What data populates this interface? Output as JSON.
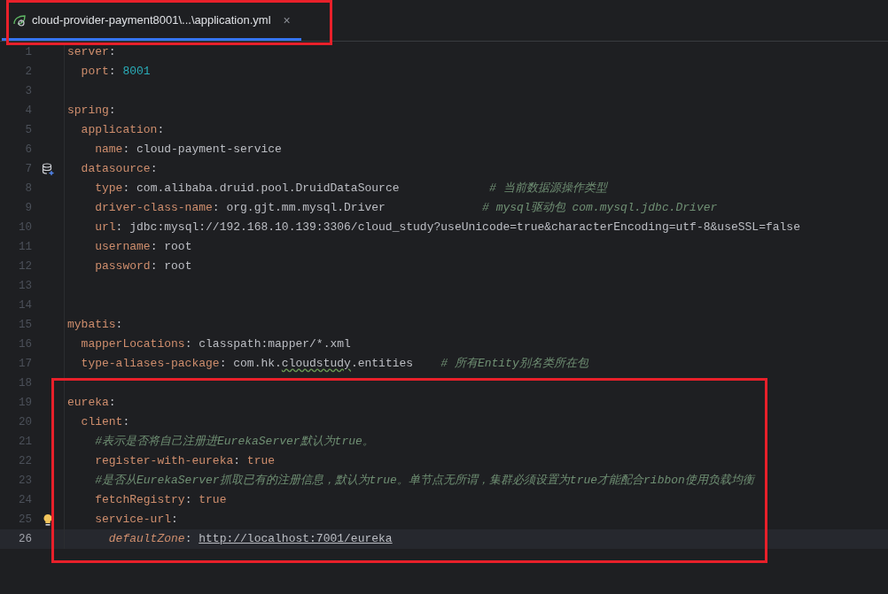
{
  "tab": {
    "label": "cloud-provider-payment8001\\...\\application.yml",
    "close": "×",
    "selected": true
  },
  "lines": [
    {
      "number": "1",
      "current": false,
      "tokens": [
        {
          "kind": "key",
          "text": "server"
        },
        {
          "kind": "punct",
          "text": ":"
        }
      ]
    },
    {
      "number": "2",
      "current": false,
      "tokens": [
        {
          "kind": "key",
          "text": "  port"
        },
        {
          "kind": "punct",
          "text": ": "
        },
        {
          "kind": "number",
          "text": "8001"
        }
      ]
    },
    {
      "number": "3",
      "current": false
    },
    {
      "number": "4",
      "current": false,
      "tokens": [
        {
          "kind": "key",
          "text": "spring"
        },
        {
          "kind": "punct",
          "text": ":"
        }
      ]
    },
    {
      "number": "5",
      "current": false,
      "tokens": [
        {
          "kind": "key",
          "text": "  application"
        },
        {
          "kind": "punct",
          "text": ":"
        }
      ]
    },
    {
      "number": "6",
      "current": false,
      "tokens": [
        {
          "kind": "key",
          "text": "    name"
        },
        {
          "kind": "punct",
          "text": ": "
        },
        {
          "kind": "value",
          "text": "cloud-payment-service"
        }
      ]
    },
    {
      "number": "7",
      "current": false,
      "kind": "database",
      "tokens": [
        {
          "kind": "key",
          "text": "  datasource"
        },
        {
          "kind": "punct",
          "text": ":"
        }
      ]
    },
    {
      "number": "8",
      "current": false,
      "tokens": [
        {
          "kind": "key",
          "text": "    type"
        },
        {
          "kind": "punct",
          "text": ": "
        },
        {
          "kind": "value",
          "text": "com.alibaba.druid.pool.DruidDataSource"
        },
        {
          "kind": "comment",
          "text": "             # 当前数据源操作类型"
        }
      ]
    },
    {
      "number": "9",
      "current": false,
      "tokens": [
        {
          "kind": "key",
          "text": "    driver-class-name"
        },
        {
          "kind": "punct",
          "text": ": "
        },
        {
          "kind": "value",
          "text": "org.gjt.mm.mysql.Driver"
        },
        {
          "kind": "comment",
          "text": "              # mysql驱动包 com.mysql.jdbc.Driver"
        }
      ]
    },
    {
      "number": "10",
      "current": false,
      "tokens": [
        {
          "kind": "key",
          "text": "    url"
        },
        {
          "kind": "punct",
          "text": ": "
        },
        {
          "kind": "value",
          "text": "jdbc:mysql://192.168.10.139:3306/cloud_study?useUnicode=true&characterEncoding=utf-8&useSSL=false"
        }
      ]
    },
    {
      "number": "11",
      "current": false,
      "tokens": [
        {
          "kind": "key",
          "text": "    username"
        },
        {
          "kind": "punct",
          "text": ": "
        },
        {
          "kind": "value",
          "text": "root"
        }
      ]
    },
    {
      "number": "12",
      "current": false,
      "tokens": [
        {
          "kind": "key",
          "text": "    password"
        },
        {
          "kind": "punct",
          "text": ": "
        },
        {
          "kind": "value",
          "text": "root"
        }
      ]
    },
    {
      "number": "13",
      "current": false
    },
    {
      "number": "14",
      "current": false
    },
    {
      "number": "15",
      "current": false,
      "tokens": [
        {
          "kind": "key",
          "text": "mybatis"
        },
        {
          "kind": "punct",
          "text": ":"
        }
      ]
    },
    {
      "number": "16",
      "current": false,
      "tokens": [
        {
          "kind": "key",
          "text": "  mapperLocations"
        },
        {
          "kind": "punct",
          "text": ": "
        },
        {
          "kind": "value",
          "text": "classpath:mapper/*.xml"
        }
      ]
    },
    {
      "number": "17",
      "current": false,
      "tokens": [
        {
          "kind": "key",
          "text": "  type-aliases-package"
        },
        {
          "kind": "punct",
          "text": ": "
        },
        {
          "kind": "value",
          "text": "com.hk."
        },
        {
          "kind": "typo",
          "text": "cloudstudy"
        },
        {
          "kind": "value",
          "text": ".entities"
        },
        {
          "kind": "comment",
          "text": "    # 所有Entity别名类所在包"
        }
      ]
    },
    {
      "number": "18",
      "current": false
    },
    {
      "number": "19",
      "current": false,
      "tokens": [
        {
          "kind": "key",
          "text": "eureka"
        },
        {
          "kind": "punct",
          "text": ":"
        }
      ]
    },
    {
      "number": "20",
      "current": false,
      "tokens": [
        {
          "kind": "key",
          "text": "  client"
        },
        {
          "kind": "punct",
          "text": ":"
        }
      ]
    },
    {
      "number": "21",
      "current": false,
      "tokens": [
        {
          "kind": "comment",
          "text": "    #表示是否将自己注册进EurekaServer默认为true。"
        }
      ]
    },
    {
      "number": "22",
      "current": false,
      "tokens": [
        {
          "kind": "key",
          "text": "    register-with-eureka"
        },
        {
          "kind": "punct",
          "text": ": "
        },
        {
          "kind": "keyword",
          "text": "true"
        }
      ]
    },
    {
      "number": "23",
      "current": false,
      "tokens": [
        {
          "kind": "comment",
          "text": "    #是否从EurekaServer抓取已有的注册信息，默认为true。单节点无所谓，集群必须设置为true才能配合ribbon使用负载均衡"
        }
      ]
    },
    {
      "number": "24",
      "current": false,
      "tokens": [
        {
          "kind": "key",
          "text": "    fetchRegistry"
        },
        {
          "kind": "punct",
          "text": ": "
        },
        {
          "kind": "keyword",
          "text": "true"
        }
      ]
    },
    {
      "number": "25",
      "current": false,
      "kind": "hint",
      "tokens": [
        {
          "kind": "key",
          "text": "    service-url"
        },
        {
          "kind": "punct",
          "text": ":"
        }
      ]
    },
    {
      "number": "26",
      "current": true,
      "tokens": [
        {
          "kind": "key_italic",
          "text": "      defaultZone"
        },
        {
          "kind": "punct",
          "text": ": "
        },
        {
          "kind": "link",
          "text": "http://localhost:7001/eureka"
        }
      ]
    }
  ]
}
